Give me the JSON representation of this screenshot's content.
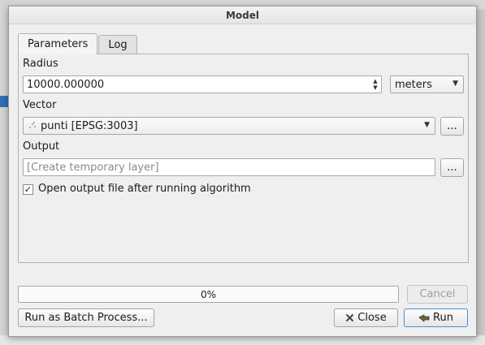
{
  "dialog": {
    "title": "Model"
  },
  "tabs": [
    {
      "label": "Parameters",
      "active": true
    },
    {
      "label": "Log",
      "active": false
    }
  ],
  "params": {
    "radius_label": "Radius",
    "radius_value": "10000.000000",
    "unit_value": "meters",
    "vector_label": "Vector",
    "vector_value": "punti [EPSG:3003]",
    "output_label": "Output",
    "output_placeholder": "[Create temporary layer]",
    "browse_label": "...",
    "open_output_label": "Open output file after running algorithm",
    "open_output_checked": true,
    "check_mark": "✓"
  },
  "progress": {
    "value": 0,
    "text": "0%"
  },
  "buttons": {
    "cancel": "Cancel",
    "batch": "Run as Batch Process...",
    "close": "Close",
    "run": "Run"
  },
  "icons": {
    "close": "close-icon",
    "run": "run-icon",
    "point_layer": "point-layer-icon"
  },
  "colors": {
    "accent": "#4a8fd6",
    "dialog_bg": "#efefef"
  }
}
